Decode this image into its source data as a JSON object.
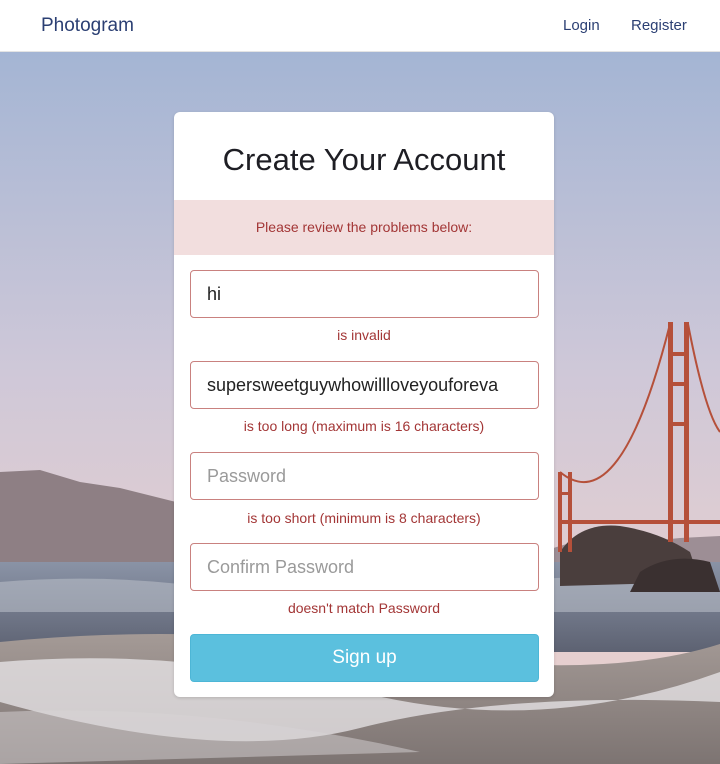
{
  "nav": {
    "brand": "Photogram",
    "login": "Login",
    "register": "Register"
  },
  "form": {
    "title": "Create Your Account",
    "alert": "Please review the problems below:",
    "username": {
      "value": "hi",
      "error": "is invalid"
    },
    "email": {
      "value": "supersweetguywhowillloveyouforeva",
      "error": "is too long (maximum is 16 characters)"
    },
    "password": {
      "placeholder": "Password",
      "error": "is too short (minimum is 8 characters)"
    },
    "password_confirmation": {
      "placeholder": "Confirm Password",
      "error": "doesn't match Password"
    },
    "submit": "Sign up"
  },
  "colors": {
    "brand": "#2b3f73",
    "error_text": "#a33636",
    "alert_bg": "#f2dede",
    "error_border": "#c9817f",
    "submit_bg": "#5bc0de"
  }
}
